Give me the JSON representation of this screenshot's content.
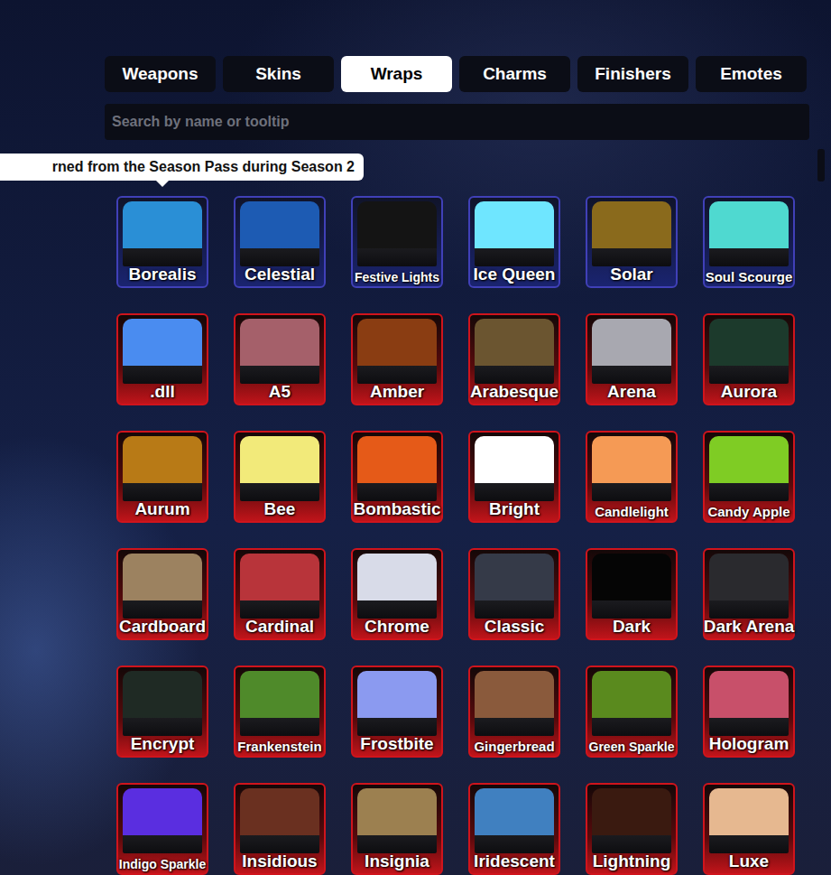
{
  "tabs": [
    {
      "label": "Weapons",
      "selected": false
    },
    {
      "label": "Skins",
      "selected": false
    },
    {
      "label": "Wraps",
      "selected": true
    },
    {
      "label": "Charms",
      "selected": false
    },
    {
      "label": "Finishers",
      "selected": false
    },
    {
      "label": "Emotes",
      "selected": false
    }
  ],
  "search": {
    "placeholder": "Search by name or tooltip"
  },
  "tooltip": {
    "text": "rned from the Season Pass during Season 2"
  },
  "wraps": [
    {
      "name": "Borealis",
      "kind": "pass",
      "color": "#2a8fd6"
    },
    {
      "name": "Celestial",
      "kind": "pass",
      "color": "#1d5bb3"
    },
    {
      "name": "Festive Lights",
      "kind": "pass",
      "color": "#141414"
    },
    {
      "name": "Ice Queen",
      "kind": "pass",
      "color": "#6fe6ff"
    },
    {
      "name": "Solar",
      "kind": "pass",
      "color": "#8a6a1c"
    },
    {
      "name": "Soul Scourge",
      "kind": "pass",
      "color": "#4fd9d0"
    },
    {
      "name": ".dll",
      "kind": "standard",
      "color": "#4a8cf0"
    },
    {
      "name": "A5",
      "kind": "standard",
      "color": "#a5606a"
    },
    {
      "name": "Amber",
      "kind": "standard",
      "color": "#8a3d12"
    },
    {
      "name": "Arabesque",
      "kind": "standard",
      "color": "#6b5530"
    },
    {
      "name": "Arena",
      "kind": "standard",
      "color": "#a8a8b0"
    },
    {
      "name": "Aurora",
      "kind": "standard",
      "color": "#1c3a2c"
    },
    {
      "name": "Aurum",
      "kind": "standard",
      "color": "#b87a16"
    },
    {
      "name": "Bee",
      "kind": "standard",
      "color": "#f2ea7a"
    },
    {
      "name": "Bombastic",
      "kind": "standard",
      "color": "#e55a18"
    },
    {
      "name": "Bright",
      "kind": "standard",
      "color": "#ffffff"
    },
    {
      "name": "Candlelight",
      "kind": "standard",
      "color": "#f59a55"
    },
    {
      "name": "Candy Apple",
      "kind": "standard",
      "color": "#7fcc24"
    },
    {
      "name": "Cardboard",
      "kind": "standard",
      "color": "#9c8260"
    },
    {
      "name": "Cardinal",
      "kind": "standard",
      "color": "#b8343a"
    },
    {
      "name": "Chrome",
      "kind": "standard",
      "color": "#d8dbe8"
    },
    {
      "name": "Classic",
      "kind": "standard",
      "color": "#353a48"
    },
    {
      "name": "Dark",
      "kind": "standard",
      "color": "#050505"
    },
    {
      "name": "Dark Arena",
      "kind": "standard",
      "color": "#2a2a2e"
    },
    {
      "name": "Encrypt",
      "kind": "standard",
      "color": "#1f2a24"
    },
    {
      "name": "Frankenstein",
      "kind": "standard",
      "color": "#4f8a2a"
    },
    {
      "name": "Frostbite",
      "kind": "standard",
      "color": "#8b9af0"
    },
    {
      "name": "Gingerbread",
      "kind": "standard",
      "color": "#8a5a3c"
    },
    {
      "name": "Green Sparkle",
      "kind": "standard",
      "color": "#5a8a1e"
    },
    {
      "name": "Hologram",
      "kind": "standard",
      "color": "#c8506a"
    },
    {
      "name": "Indigo Sparkle",
      "kind": "standard",
      "color": "#5a2ee0"
    },
    {
      "name": "Insidious",
      "kind": "standard",
      "color": "#6a3020"
    },
    {
      "name": "Insignia",
      "kind": "standard",
      "color": "#9c8050"
    },
    {
      "name": "Iridescent",
      "kind": "standard",
      "color": "#4080c0"
    },
    {
      "name": "Lightning",
      "kind": "standard",
      "color": "#3a1a10"
    },
    {
      "name": "Luxe",
      "kind": "standard",
      "color": "#e6b890"
    }
  ]
}
